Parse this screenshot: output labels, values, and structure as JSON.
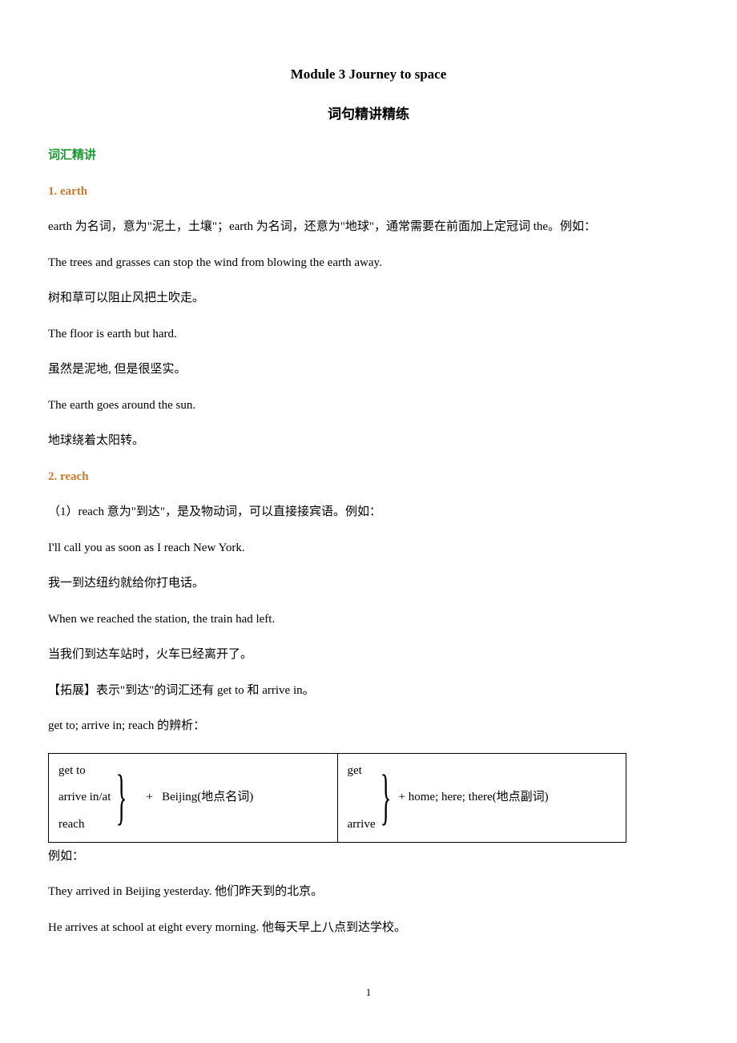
{
  "titles": {
    "main": "Module 3 Journey to space",
    "sub": "词句精讲精练"
  },
  "section_heading": "词汇精讲",
  "vocab1": {
    "heading": "1. earth",
    "p1": "earth 为名词，意为\"泥土，土壤\"；earth 为名词，还意为\"地球\"，通常需要在前面加上定冠词 the。例如：",
    "p2": "The trees and grasses can stop the wind from blowing the earth away.",
    "p3": "树和草可以阻止风把土吹走。",
    "p4": "The floor is earth but hard.",
    "p5": "虽然是泥地, 但是很坚实。",
    "p6": "The earth goes around the sun.",
    "p7": "地球绕着太阳转。"
  },
  "vocab2": {
    "heading": "2. reach",
    "p1": "（1）reach 意为\"到达\"，是及物动词，可以直接接宾语。例如：",
    "p2": "I'll call you as soon as I reach New York.",
    "p3": "我一到达纽约就给你打电话。",
    "p4": "When we reached the station, the train had left.",
    "p5": "当我们到达车站时，火车已经离开了。",
    "p6": "【拓展】表示\"到达\"的词汇还有 get to 和  arrive in。",
    "p7": "get to; arrive in; reach 的辨析："
  },
  "table": {
    "left": {
      "r1": "get to",
      "r2": "arrive in/at",
      "r3": "reach",
      "suffix": "    +   Beijing(地点名词)"
    },
    "right": {
      "r1": "get",
      "r2": "",
      "r3": "arrive",
      "suffix": " + home; here; there(地点副词)"
    }
  },
  "after_table": {
    "p1": "例如：",
    "p2": "They arrived in Beijing yesterday.  他们昨天到的北京。",
    "p3": "He arrives at school at eight every morning.  他每天早上八点到达学校。"
  },
  "page_number": "1"
}
